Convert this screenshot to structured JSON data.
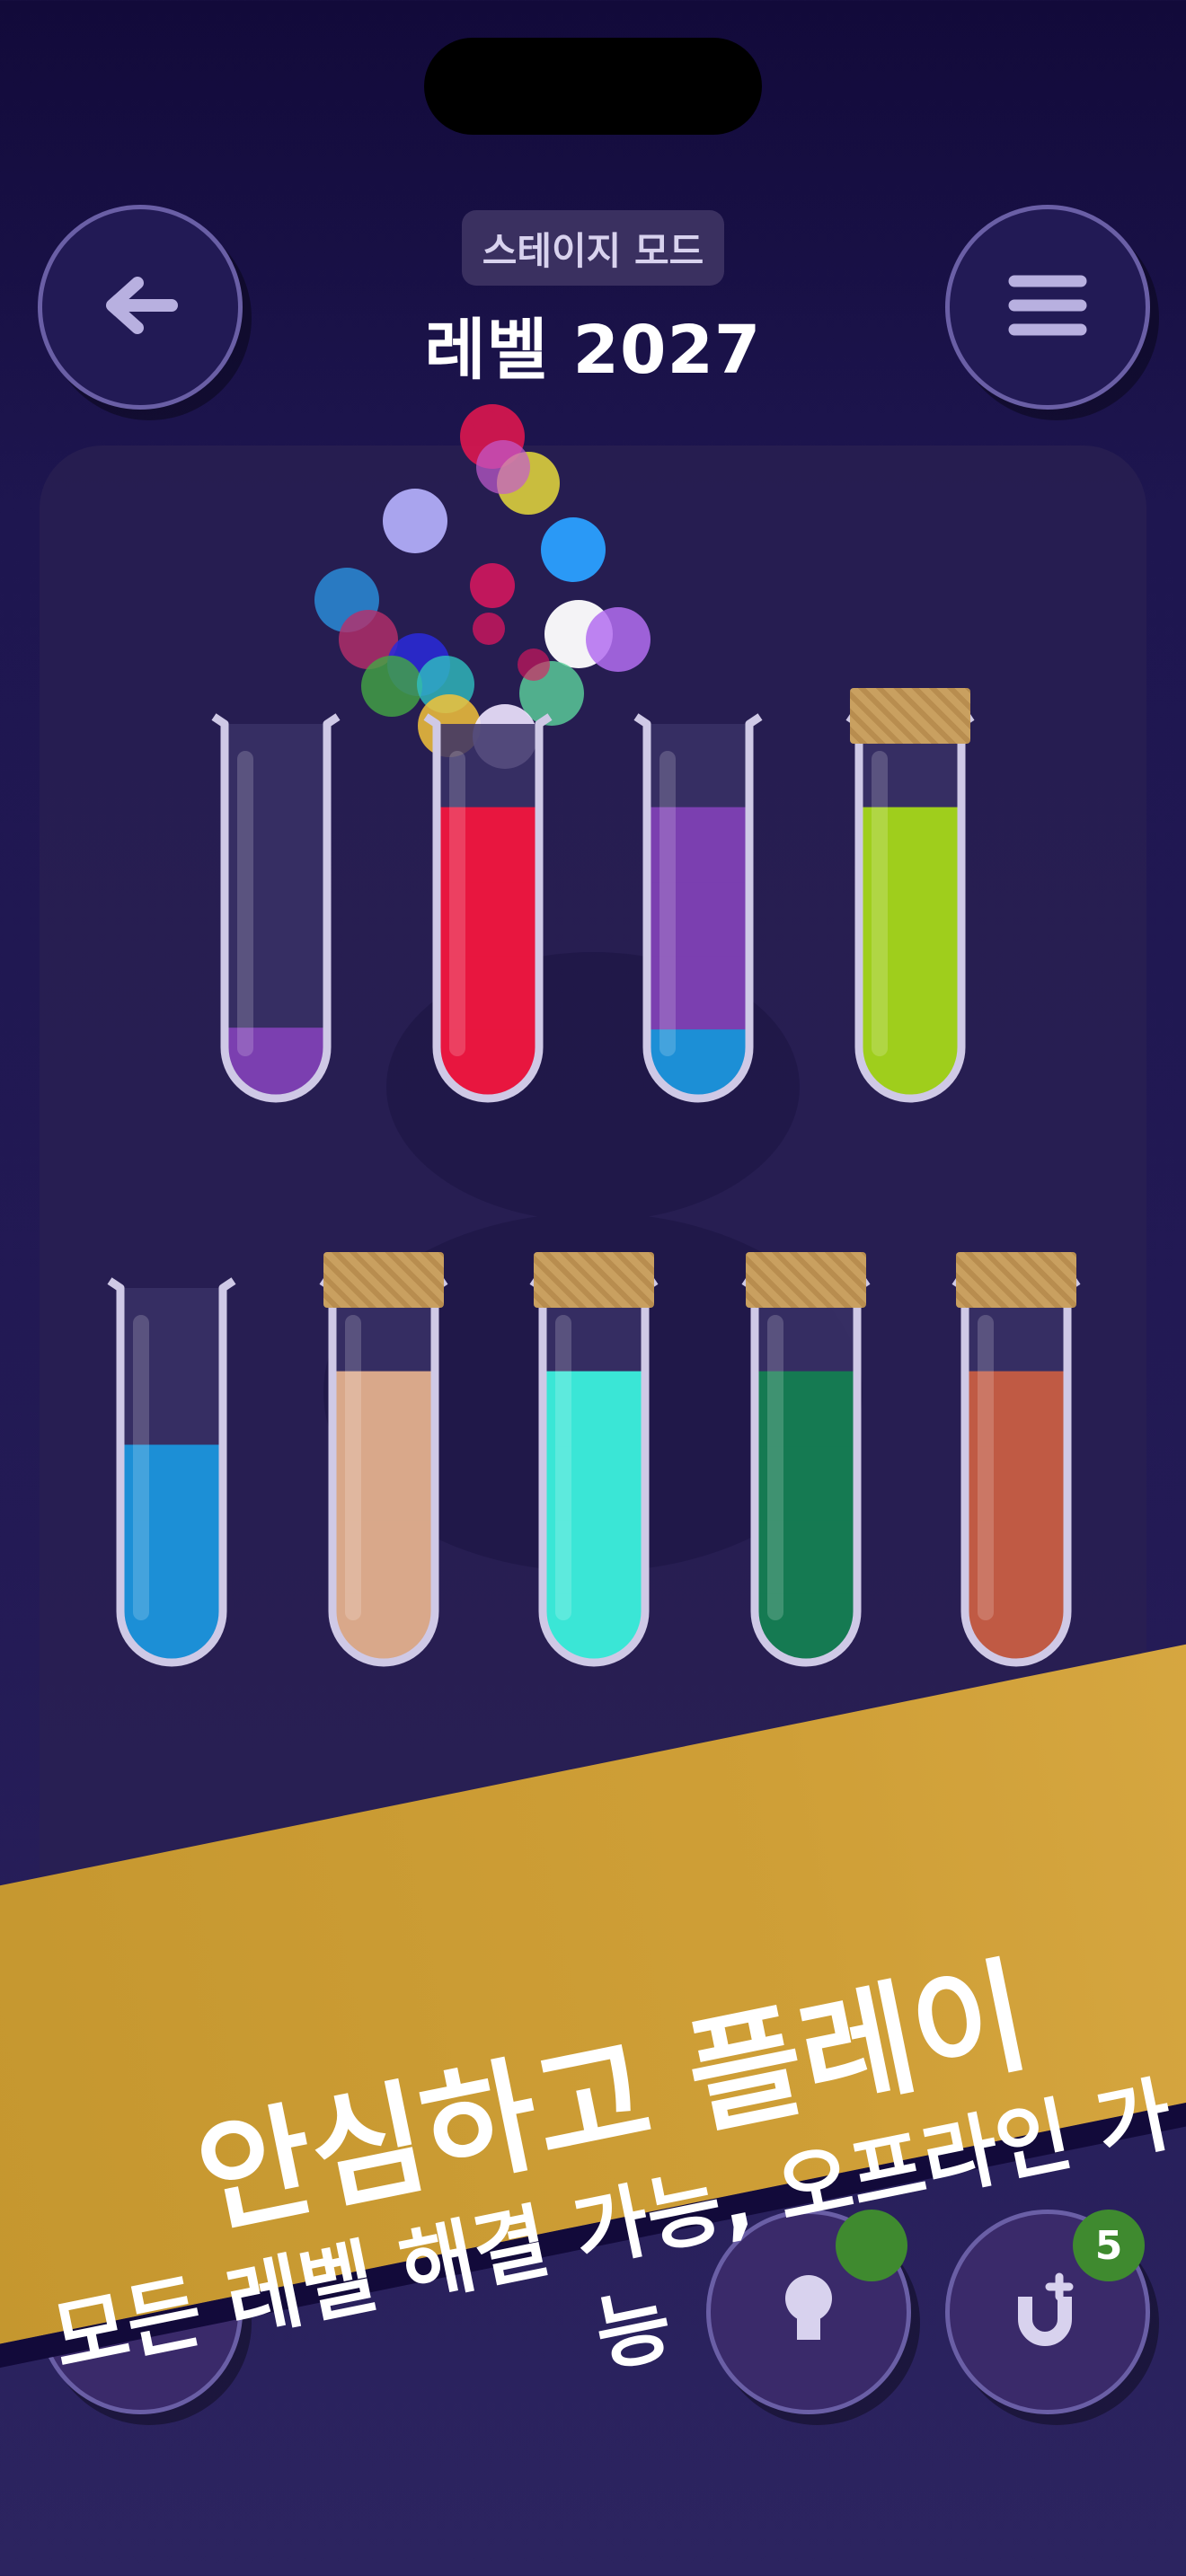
{
  "header": {
    "mode_label": "스테이지 모드",
    "level_label": "레벨 2027",
    "back_icon": "arrow-left-icon",
    "menu_icon": "hamburger-menu-icon"
  },
  "tubes": {
    "row1": [
      {
        "id": "tube-1",
        "layers": [
          "#7b3fb0"
        ],
        "corked": false
      },
      {
        "id": "tube-2",
        "layers": [
          "#e8163f",
          "#e8163f",
          "#e8163f",
          "#e8163f"
        ],
        "corked": false
      },
      {
        "id": "tube-3",
        "layers": [
          "#1c8fd6",
          "#7b3fb0",
          "#7b3fb0",
          "#7b3fb0"
        ],
        "corked": false
      },
      {
        "id": "tube-4",
        "layers": [
          "#9fce1c",
          "#9fce1c",
          "#9fce1c",
          "#9fce1c"
        ],
        "corked": true
      }
    ],
    "row2": [
      {
        "id": "tube-5",
        "layers": [
          "#1c8fd6",
          "#1c8fd6",
          "#1c8fd6"
        ],
        "corked": false
      },
      {
        "id": "tube-6",
        "layers": [
          "#d9a88a",
          "#d9a88a",
          "#d9a88a",
          "#d9a88a"
        ],
        "corked": true
      },
      {
        "id": "tube-7",
        "layers": [
          "#3ae6d6",
          "#3ae6d6",
          "#3ae6d6",
          "#3ae6d6"
        ],
        "corked": true
      },
      {
        "id": "tube-8",
        "layers": [
          "#157a52",
          "#157a52",
          "#157a52",
          "#157a52"
        ],
        "corked": true
      },
      {
        "id": "tube-9",
        "layers": [
          "#c05a44",
          "#c05a44",
          "#c05a44",
          "#c05a44"
        ],
        "corked": true
      }
    ]
  },
  "banner": {
    "title": "안심하고 플레이",
    "subtitle": "모든 레벨 해결 가능, 오프라인 가능"
  },
  "toolbar": {
    "hint_icon": "lightbulb-icon",
    "magnet_icon": "magnet-plus-icon",
    "magnet_count": "5"
  },
  "colors": {
    "accent": "#cf9f37",
    "background": "#1e1650",
    "button_border": "#6a5fa6"
  }
}
